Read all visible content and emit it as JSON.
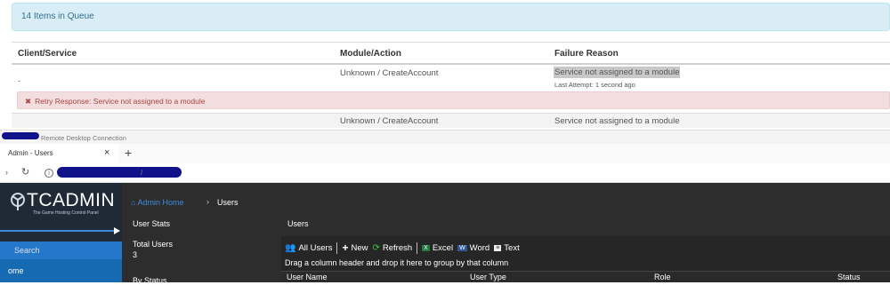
{
  "queue": {
    "banner": "14 Items in Queue",
    "columns": [
      "Client/Service",
      "Module/Action",
      "Failure Reason"
    ],
    "rows": [
      {
        "client": "-",
        "module_action": "Unknown / CreateAccount",
        "reason": "Service not assigned to a module",
        "last_attempt": "Last Attempt: 1 second ago",
        "retry_response": "Retry Response: Service not assigned to a module"
      },
      {
        "module_action": "Unknown / CreateAccount",
        "reason": "Service not assigned to a module"
      }
    ]
  },
  "remote_desktop": {
    "title_suffix": "Remote Desktop Connection"
  },
  "browser": {
    "tab_title": "Admin - Users",
    "tab_close": "×",
    "new_tab": "+",
    "url_fragment": "/"
  },
  "app": {
    "logo_text": "TCADMIN",
    "logo_tagline": "The Game Hosting Control Panel",
    "search_placeholder": "Search",
    "nav_home": "ome",
    "breadcrumb": {
      "home": "Admin Home",
      "separator": "›",
      "current": "Users"
    },
    "stats": {
      "title": "User Stats",
      "total_users_label": "Total Users",
      "total_users_value": "3",
      "by_status_label": "By Status"
    },
    "users_panel": {
      "title": "Users",
      "toolbar": {
        "all_users": "All Users",
        "new": "New",
        "refresh": "Refresh",
        "excel": "Excel",
        "word": "Word",
        "text": "Text"
      },
      "group_hint": "Drag a column header and drop it here to group by that column",
      "columns": [
        "User Name",
        "User Type",
        "Role",
        "Status"
      ]
    }
  },
  "colors": {
    "info_bg": "#d9edf7",
    "info_text": "#31708f",
    "danger_bg": "#f2dede",
    "danger_text": "#a94442",
    "sidebar_accent": "#2577c9",
    "link_blue": "#3c8dde",
    "app_bg": "#2d2d2d"
  }
}
